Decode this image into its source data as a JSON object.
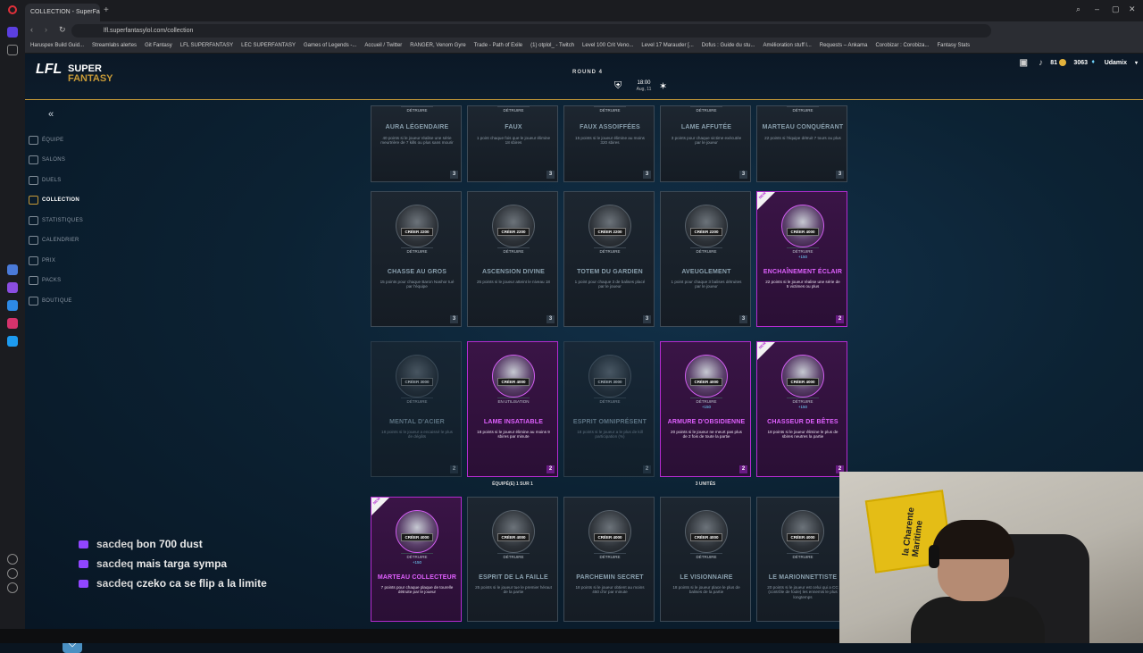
{
  "browser": {
    "tab_title": "COLLECTION - SuperFa...",
    "url": "lfl.superfantasylol.com/collection",
    "bookmarks": [
      "Haruspex Build Guid...",
      "Streamlabs alertes",
      "Git Fantasy",
      "LFL SUPERFANTASY",
      "LEC SUPERFANTASY",
      "Games of Legends -...",
      "Accueil / Twitter",
      "RANGER, Venom Gyre",
      "Trade - Path of Exile",
      "(1) otplol_ - Twitch",
      "Level 100 Crit Veno...",
      "Level 17 Marauder [...",
      "Dofus : Guide du stu...",
      "Amélioration stuff l...",
      "Requests – Ankama",
      "Corobizar : Corobiza...",
      "Fantasy Stats"
    ]
  },
  "header": {
    "logo_line1": "LFL",
    "logo_line2": "SUPER",
    "logo_line3": "FANTASY",
    "round": "ROUND 4",
    "match_time": "18:00",
    "match_date": "Aug, 11",
    "coins_left": "81",
    "coins_right": "3063",
    "username": "Udamix"
  },
  "nav": {
    "items": [
      {
        "label": "ÉQUIPE",
        "icon": "team-icon"
      },
      {
        "label": "SALONS",
        "icon": "lobby-icon"
      },
      {
        "label": "DUELS",
        "icon": "swords-icon"
      },
      {
        "label": "COLLECTION",
        "icon": "collection-icon"
      },
      {
        "label": "STATISTIQUES",
        "icon": "stats-icon"
      },
      {
        "label": "CALENDRIER",
        "icon": "calendar-icon"
      },
      {
        "label": "PRIX",
        "icon": "prize-icon"
      },
      {
        "label": "PACKS",
        "icon": "pack-icon"
      },
      {
        "label": "BOUTIQUE",
        "icon": "shop-icon"
      }
    ]
  },
  "cards_row1": [
    {
      "title": "AURA LÉGENDAIRE",
      "desc": "40 points si le joueur réalise une série meurtrière de 7 kills ou plus sans mourir",
      "count": "3",
      "btn_top": "DÉTRUIRE"
    },
    {
      "title": "FAUX",
      "desc": "1 point chaque fois que le joueur élimine 18 sbires",
      "count": "3",
      "btn_top": "DÉTRUIRE"
    },
    {
      "title": "FAUX ASSOIFFÉES",
      "desc": "15 points si le joueur élimine au moins 320 sbires",
      "count": "3",
      "btn_top": "DÉTRUIRE"
    },
    {
      "title": "LAME AFFUTÉE",
      "desc": "3 points pour chaque victime exécutée par le joueur",
      "count": "3",
      "btn_top": "DÉTRUIRE"
    },
    {
      "title": "MARTEAU CONQUÉRANT",
      "desc": "22 points si l'équipe détruit 7 tours ou plus",
      "count": "3",
      "btn_top": "DÉTRUIRE"
    }
  ],
  "cards_row2": [
    {
      "title": "CHASSE AU GROS",
      "desc": "15 points pour chaque Baron Nashor tué par l'équipe",
      "count": "3",
      "create": "CRÉER 2200",
      "destroy": "DÉTRUIRE"
    },
    {
      "title": "ASCENSION DIVINE",
      "desc": "25 points si le joueur atteint le niveau 18",
      "count": "3",
      "create": "CRÉER 2200",
      "destroy": "DÉTRUIRE"
    },
    {
      "title": "TOTEM DU GARDIEN",
      "desc": "1 point pour chaque 3 de balises placé par le joueur",
      "count": "3",
      "create": "CRÉER 2200",
      "destroy": "DÉTRUIRE"
    },
    {
      "title": "AVEUGLEMENT",
      "desc": "1 point pour chaque 3 balises détruites par le joueur",
      "count": "3",
      "create": "CRÉER 2200",
      "destroy": "DÉTRUIRE"
    },
    {
      "title": "ENCHAÎNEMENT ÉCLAIR",
      "desc": "22 points si le joueur réalise une série de 5 victimes ou plus",
      "count": "2",
      "create": "CRÉER 4000",
      "destroy": "DÉTRUIRE",
      "dust": "+150",
      "new": "NEW"
    }
  ],
  "cards_row3": [
    {
      "title": "MENTAL D'ACIER",
      "desc": "18 points si le joueur a encaissé le plus de dégâts",
      "count": "2",
      "create": "CRÉER 3000",
      "destroy": "DÉTRUIRE"
    },
    {
      "title": "LAME INSATIABLE",
      "desc": "18 points si le joueur élimine au moins 9 sbires par minute",
      "count": "2",
      "create": "CRÉER 4000",
      "destroy": "EN UTILISATION"
    },
    {
      "title": "ESPRIT OMNIPRÉSENT",
      "desc": "18 points si le joueur a le plus de kill participation (%)",
      "count": "2",
      "create": "CRÉER 3000",
      "destroy": "DÉTRUIRE"
    },
    {
      "title": "ARMURE D'OBSIDIENNE",
      "desc": "20 points si le joueur ne meurt pas plus de 2 fois de toute la partie",
      "count": "2",
      "create": "CRÉER 4000",
      "destroy": "DÉTRUIRE",
      "dust": "+150"
    },
    {
      "title": "CHASSEUR DE BÊTES",
      "desc": "18 points si le joueur élimine le plus de sbires neutres la partie",
      "count": "2",
      "create": "CRÉER 4000",
      "destroy": "DÉTRUIRE",
      "dust": "+150",
      "new": "NEW"
    }
  ],
  "row3_notes": [
    "ÉQUIPÉ(E) 1 SUR 1",
    "3 UNITÉS"
  ],
  "cards_row4": [
    {
      "title": "MARTEAU COLLECTEUR",
      "desc": "7 points pour chaque plaque de tourelle détruite par le joueur",
      "create": "CRÉER 4000",
      "destroy": "DÉTRUIRE",
      "dust": "+150",
      "new": "NEW"
    },
    {
      "title": "ESPRIT DE LA FAILLE",
      "desc": "25 points si le joueur tue le premier héraut de la partie",
      "create": "CRÉER 4000",
      "destroy": "DÉTRUIRE"
    },
    {
      "title": "PARCHEMIN SECRET",
      "desc": "18 points si le joueur obtient au moins 450 d'or par minute",
      "create": "CRÉER 4000",
      "destroy": "DÉTRUIRE"
    },
    {
      "title": "LE VISIONNAIRE",
      "desc": "18 points si le joueur place le plus de balises de la partie",
      "create": "CRÉER 4000",
      "destroy": "DÉTRUIRE"
    },
    {
      "title": "LE MARIONNETTISTE",
      "desc": "20 points si le joueur est celui qui a CC (contrôle de foule) les ennemis le plus longtemps",
      "create": "CRÉER 4000",
      "destroy": "DÉTRUIRE"
    }
  ],
  "chat": [
    {
      "user": "sacdeq",
      "msg": "bon 700 dust"
    },
    {
      "user": "sacdeq",
      "msg": "mais targa sympa"
    },
    {
      "user": "sacdeq",
      "msg": "czeko ca se flip a la limite"
    }
  ],
  "webcam": {
    "flag_text": "la Charente Maritime"
  },
  "colors": {
    "accent_gold": "#c79a37",
    "epic_purple": "#b52bd0",
    "twitch_purple": "#9146ff"
  }
}
